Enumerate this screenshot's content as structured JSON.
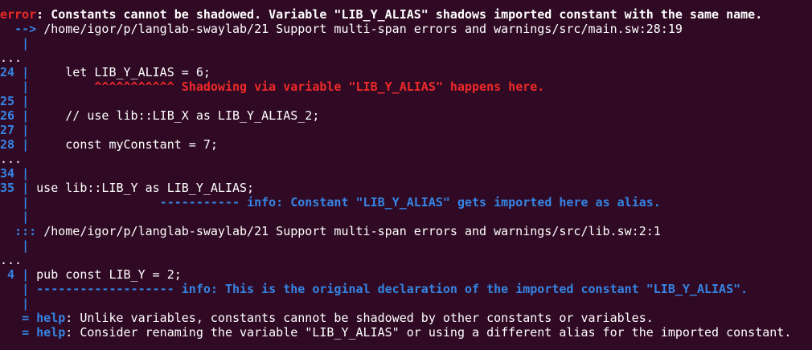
{
  "colors": {
    "background": "#300a24",
    "error_red": "#ef2929",
    "gutter_blue": "#3584e4",
    "text": "#ffffff"
  },
  "error": {
    "prefix": "error",
    "message": ": Constants cannot be shadowed. Variable \"LIB_Y_ALIAS\" shadows imported constant with the same name."
  },
  "source1": {
    "arrow": "-->",
    "path": "/home/igor/p/langlab-swaylab/21 Support multi-span errors and warnings/src/main.sw:28:19"
  },
  "gutter": {
    "bar": "|",
    "ellipsis": "..."
  },
  "code1": [
    {
      "num": "24",
      "text": "let LIB_Y_ALIAS = 6;"
    },
    {
      "num": "25",
      "text": ""
    },
    {
      "num": "26",
      "text": "// use lib::LIB_X as LIB_Y_ALIAS_2;"
    },
    {
      "num": "27",
      "text": ""
    },
    {
      "num": "28",
      "text": "const myConstant = 7;"
    }
  ],
  "annotation1": {
    "marker": "^^^^^^^^^^^",
    "text": "Shadowing via variable \"LIB_Y_ALIAS\" happens here."
  },
  "code2": [
    {
      "num": "34",
      "text": ""
    },
    {
      "num": "35",
      "text": "use lib::LIB_Y as LIB_Y_ALIAS;"
    }
  ],
  "annotation2": {
    "marker": "-----------",
    "text": "info: Constant \"LIB_Y_ALIAS\" gets imported here as alias."
  },
  "source2": {
    "arrow": ":::",
    "path": "/home/igor/p/langlab-swaylab/21 Support multi-span errors and warnings/src/lib.sw:2:1"
  },
  "code3": [
    {
      "num": "4",
      "text": "pub const LIB_Y = 2;"
    }
  ],
  "annotation3": {
    "marker": "-------------------",
    "text": "info: This is the original declaration of the imported constant \"LIB_Y_ALIAS\"."
  },
  "help": [
    {
      "eq": "=",
      "label": "help",
      "text": ": Unlike variables, constants cannot be shadowed by other constants or variables."
    },
    {
      "eq": "=",
      "label": "help",
      "text": ": Consider renaming the variable \"LIB_Y_ALIAS\" or using a different alias for the imported constant."
    }
  ]
}
